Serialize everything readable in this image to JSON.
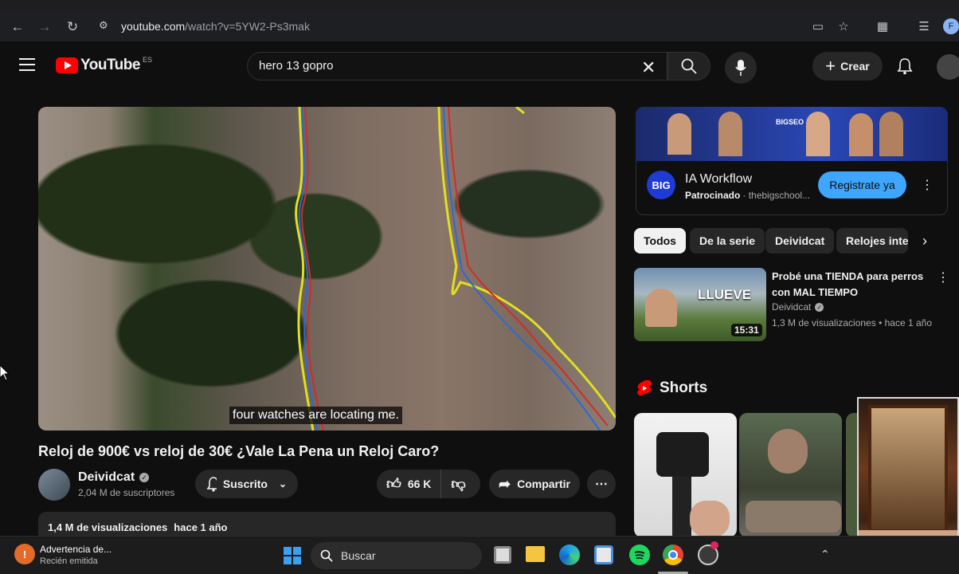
{
  "browser": {
    "url_host": "youtube.com",
    "url_path": "/watch?v=5YW2-Ps3mak",
    "profile_initial": "F"
  },
  "header": {
    "logo_text": "YouTube",
    "country_code": "ES",
    "search_value": "hero 13 gopro",
    "create_label": "Crear"
  },
  "video": {
    "subtitle": "four watches are locating me.",
    "title": "Reloj de 900€ vs reloj de 30€ ¿Vale La Pena un Reloj Caro?",
    "channel_name": "Deividcat",
    "subscribers": "2,04 M de suscriptores",
    "subscribed_label": "Suscrito",
    "likes": "66 K",
    "share_label": "Compartir",
    "views": "1,4 M de visualizaciones",
    "age": "hace 1 año"
  },
  "ad": {
    "brand_initials": "BIG",
    "title": "IA Workflow",
    "sponsored": "Patrocinado",
    "advertiser": "· thebigschool...",
    "cta": "Registrate ya",
    "banner_text": "BIGSEO"
  },
  "chips": [
    "Todos",
    "De la serie",
    "Deividcat",
    "Relojes inte"
  ],
  "recommendation": {
    "title": "Probé una TIENDA para perros con MAL TIEMPO",
    "channel": "Deividcat",
    "meta": "1,3 M de visualizaciones • hace 1 año",
    "duration": "15:31",
    "thumb_text": "LLUEVE"
  },
  "shorts": {
    "heading": "Shorts"
  },
  "taskbar": {
    "notification_title": "Advertencia de...",
    "notification_sub": "Recién emitida",
    "search_label": "Buscar"
  }
}
